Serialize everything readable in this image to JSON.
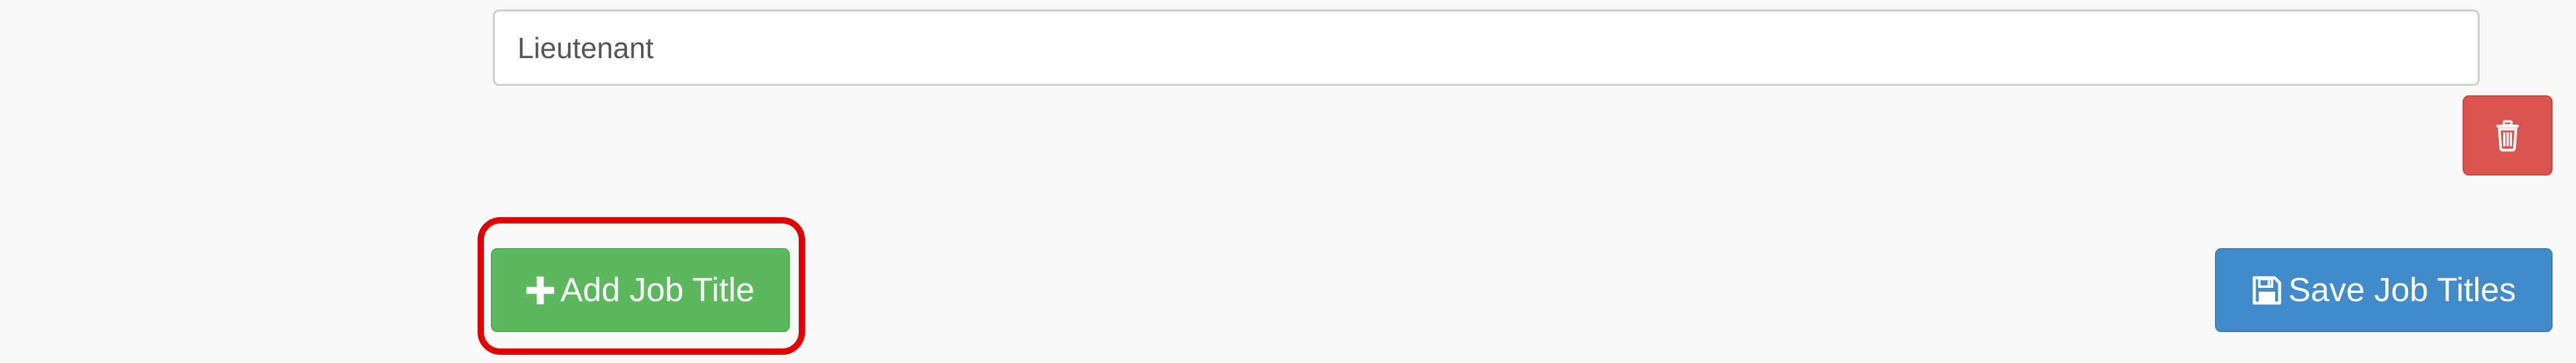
{
  "form": {
    "job_title_value": "Lieutenant"
  },
  "buttons": {
    "add_job_title_label": "Add Job Title",
    "save_job_titles_label": "Save Job Titles",
    "add_icon": "plus-icon",
    "save_icon": "floppy-disk-icon",
    "delete_icon": "trash-icon"
  },
  "colors": {
    "page_background": "#f9f9f9",
    "add_button": "#5cb85c",
    "save_button": "#428bca",
    "delete_button": "#d9534f",
    "highlight_outline": "#e00000"
  }
}
